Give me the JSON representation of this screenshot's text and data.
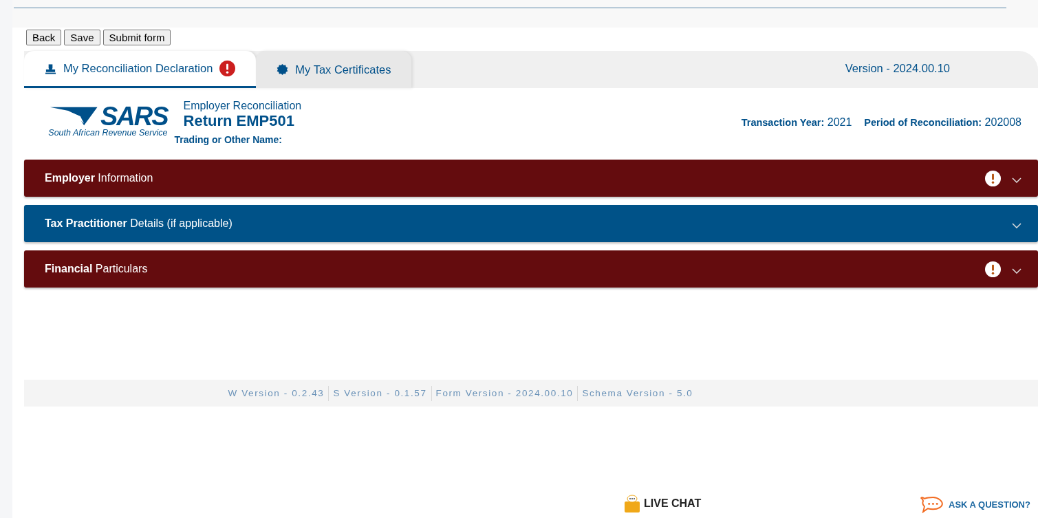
{
  "toolbar": {
    "buttons": [
      "Back",
      "Save",
      "Submit form"
    ]
  },
  "tabs": [
    {
      "label": "My Reconciliation Declaration",
      "selected": true,
      "warning": true,
      "kind": "stamp"
    },
    {
      "label": "My Tax Certificates",
      "selected": false,
      "warning": false,
      "kind": "badge"
    }
  ],
  "version": "Version - 2024.00.10",
  "header": {
    "logo_text": "SARS",
    "logo_tagline": "South African Revenue Service",
    "subtitle": "Employer Reconciliation",
    "title": "Return EMP501",
    "trading_name_label": "Trading or Other Name:",
    "transaction_year_label": "Transaction Year:",
    "transaction_year": "2021",
    "period_label": "Period of Reconciliation:",
    "period": "202008"
  },
  "sections": [
    {
      "title": "**Employer** Information",
      "color": "#640c0e",
      "warning": true,
      "expanded": false
    },
    {
      "title": "**Tax Practitioner** Details (if applicable)",
      "color": "#005288",
      "warning": false,
      "expanded": false
    },
    {
      "title": "**Financial** Particulars",
      "color": "#640c0e",
      "warning": true,
      "expanded": false
    }
  ],
  "footer_versions": [
    "W Version - 0.2.43",
    "S Version - 0.1.57",
    "Form Version - 2024.00.10",
    "Schema Version - 5.0"
  ],
  "live_chat": "LIVE CHAT",
  "ask_question": "ASK A QUESTION?"
}
